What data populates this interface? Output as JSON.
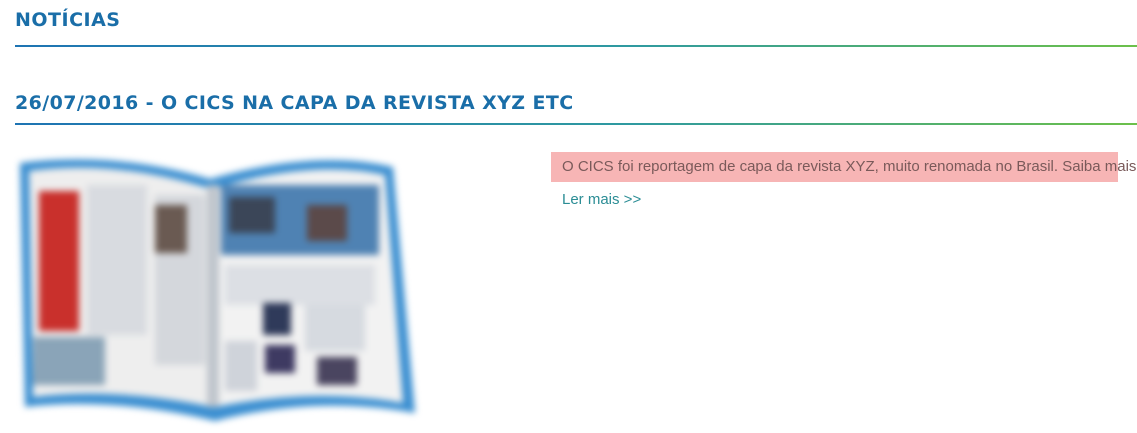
{
  "section": {
    "title": "NOTÍCIAS"
  },
  "news": {
    "title": "26/07/2016 - O CICS NA CAPA DA REVISTA XYZ ETC",
    "summary": "O CICS foi reportagem de capa da revista XYZ, muito renomada no Brasil. Saiba mais",
    "read_more": "Ler mais >>"
  },
  "colors": {
    "heading": "#1a6ea8",
    "link": "#2b8d95",
    "highlight": "#f7b5b5",
    "rule_start": "#1e74b3",
    "rule_end": "#6cc04a"
  }
}
